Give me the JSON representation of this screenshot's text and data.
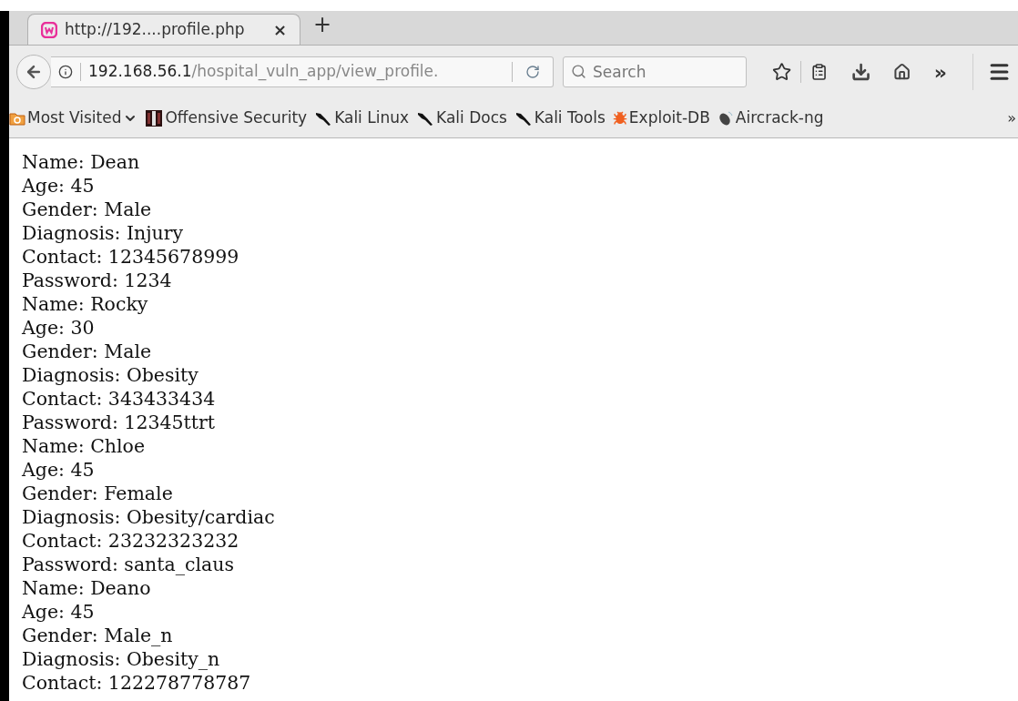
{
  "tab": {
    "title": "http://192....profile.php",
    "close": "×",
    "new_tab": "+"
  },
  "address_bar": {
    "host": "192.168.56.1",
    "path": "/hospital_vuln_app/view_profile."
  },
  "search": {
    "placeholder": "Search"
  },
  "toolbar": {
    "overflow": "»"
  },
  "bookmarks": [
    {
      "label": "Most Visited",
      "kind": "folder"
    },
    {
      "label": "Offensive Security",
      "kind": "offsec"
    },
    {
      "label": "Kali Linux",
      "kind": "kali"
    },
    {
      "label": "Kali Docs",
      "kind": "kali"
    },
    {
      "label": "Kali Tools",
      "kind": "kali"
    },
    {
      "label": "Exploit-DB",
      "kind": "bug"
    },
    {
      "label": "Aircrack-ng",
      "kind": "dish"
    }
  ],
  "bookmarks_overflow": "»",
  "page": {
    "lines": [
      "Name: Dean",
      "Age: 45",
      "Gender: Male",
      "Diagnosis: Injury",
      "Contact: 12345678999",
      "Password: 1234",
      "Name: Rocky",
      "Age: 30",
      "Gender: Male",
      "Diagnosis: Obesity",
      "Contact: 343433434",
      "Password: 12345ttrt",
      "Name: Chloe",
      "Age: 45",
      "Gender: Female",
      "Diagnosis: Obesity/cardiac",
      "Contact: 23232323232",
      "Password: santa_claus",
      "Name: Deano",
      "Age: 45",
      "Gender: Male_n",
      "Diagnosis: Obesity_n",
      "Contact: 122278778787"
    ]
  }
}
